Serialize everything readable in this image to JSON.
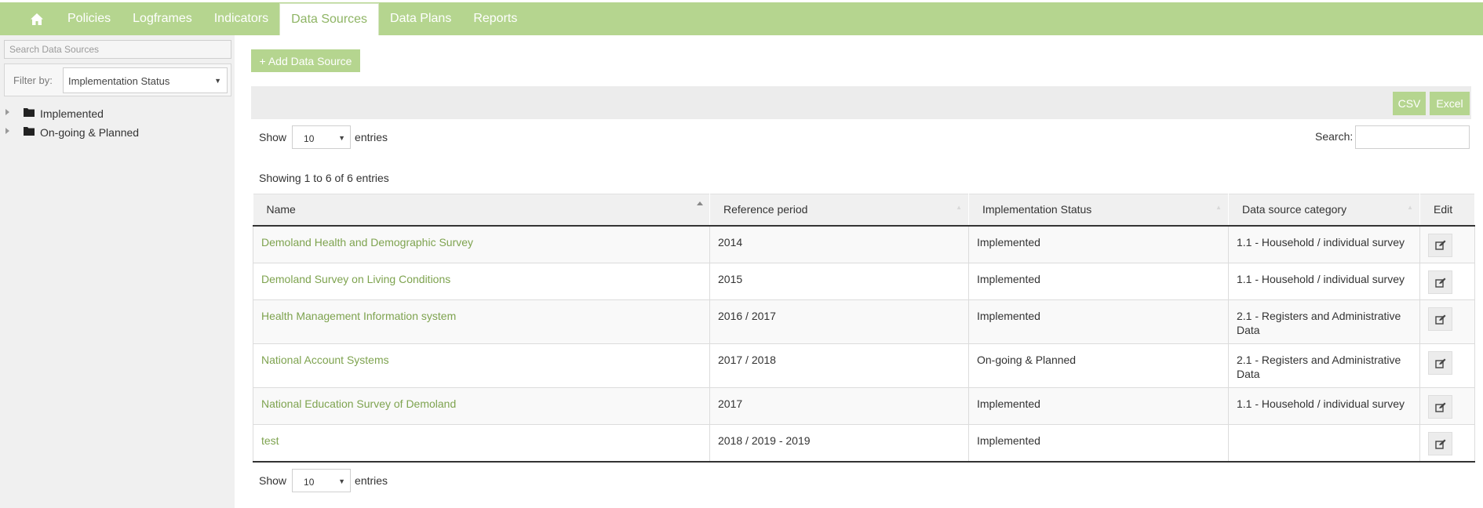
{
  "nav": {
    "home_icon": "home-icon",
    "items": [
      "Policies",
      "Logframes",
      "Indicators",
      "Data Sources",
      "Data Plans",
      "Reports"
    ],
    "active": "Data Sources"
  },
  "sidebar": {
    "search_placeholder": "Search Data Sources",
    "filter_label": "Filter by:",
    "filter_value": "Implementation Status",
    "tree": [
      {
        "label": "Implemented",
        "icon": "folder-icon"
      },
      {
        "label": "On-going & Planned",
        "icon": "folder-icon"
      }
    ]
  },
  "main": {
    "add_button": "+ Add Data Source",
    "export": {
      "csv": "CSV",
      "excel": "Excel"
    },
    "length": {
      "show": "Show",
      "value": "10",
      "entries": "entries"
    },
    "search_label": "Search:",
    "info": "Showing 1 to 6 of 6 entries",
    "table": {
      "columns": [
        "Name",
        "Reference period",
        "Implementation Status",
        "Data source category",
        "Edit"
      ],
      "rows": [
        {
          "name": "Demoland Health and Demographic Survey",
          "period": "2014",
          "status": "Implemented",
          "category": "1.1 - Household / individual survey"
        },
        {
          "name": "Demoland Survey on Living Conditions",
          "period": "2015",
          "status": "Implemented",
          "category": "1.1 - Household / individual survey"
        },
        {
          "name": "Health Management Information system",
          "period": "2016 / 2017",
          "status": "Implemented",
          "category": "2.1 - Registers and Administrative Data"
        },
        {
          "name": "National Account Systems",
          "period": "2017 / 2018",
          "status": "On-going & Planned",
          "category": "2.1 - Registers and Administrative Data"
        },
        {
          "name": "National Education Survey of Demoland",
          "period": "2017",
          "status": "Implemented",
          "category": "1.1 - Household / individual survey"
        },
        {
          "name": "test",
          "period": "2018 / 2019 - 2019",
          "status": "Implemented",
          "category": ""
        }
      ]
    }
  },
  "colors": {
    "brand_green": "#b5d58f",
    "link_green": "#7ea34f"
  }
}
